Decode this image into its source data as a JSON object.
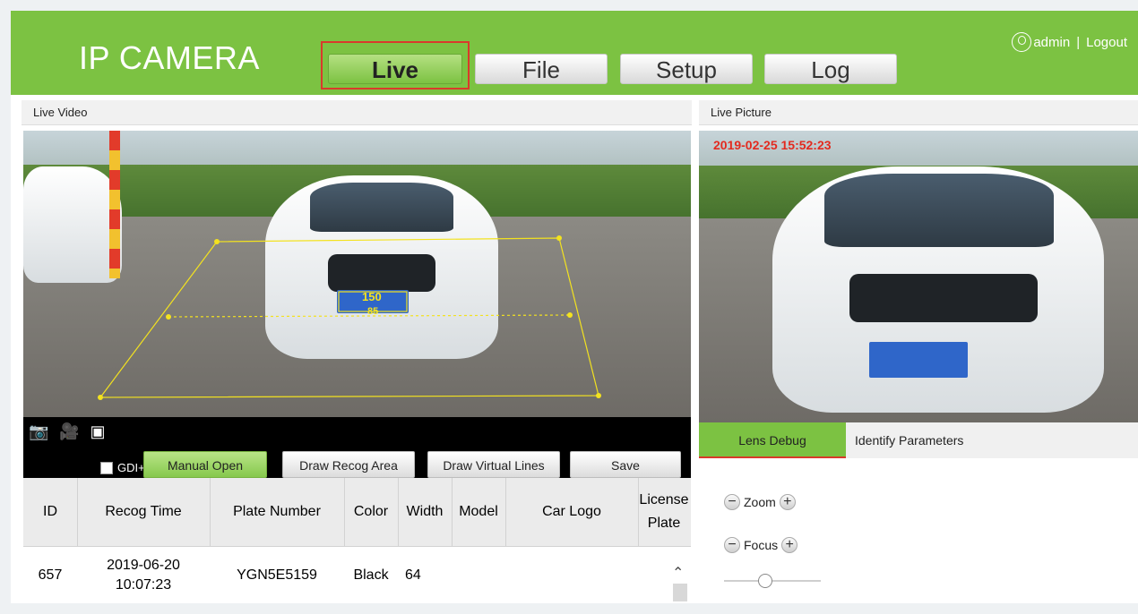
{
  "header": {
    "brand": "IP CAMERA",
    "tabs": [
      "Live",
      "File",
      "Setup",
      "Log"
    ],
    "active_tab": "Live",
    "user": "admin",
    "separator": "|",
    "logout": "Logout"
  },
  "sections": {
    "live_video": "Live Video",
    "live_picture": "Live Picture"
  },
  "overlay": {
    "top_value": "150",
    "bottom_value": "85",
    "timestamp": "2019-02-25 15:52:23"
  },
  "controls": {
    "gdi_label": "GDI+",
    "gdi_checked": false,
    "manual_open": "Manual Open",
    "draw_recog_area": "Draw Recog Area",
    "draw_virtual_lines": "Draw Virtual Lines",
    "save": "Save"
  },
  "table": {
    "headers": [
      "ID",
      "Recog Time",
      "Plate Number",
      "Color",
      "Width",
      "Model",
      "Car Logo",
      "License Plate"
    ],
    "rows": [
      {
        "id": "657",
        "time_date": "2019-06-20",
        "time_clock": "10:07:23",
        "plate": "YGN5E5159",
        "color": "Black",
        "width": "64",
        "model": "",
        "logo": "",
        "license": ""
      }
    ]
  },
  "right_tabs": [
    "Lens Debug",
    "Identify Parameters"
  ],
  "lens": {
    "zoom": "Zoom",
    "focus": "Focus"
  },
  "colors": {
    "header_green": "#7cc242",
    "highlight_red": "#d93a2b",
    "overlay_yellow": "#f3e21f"
  }
}
